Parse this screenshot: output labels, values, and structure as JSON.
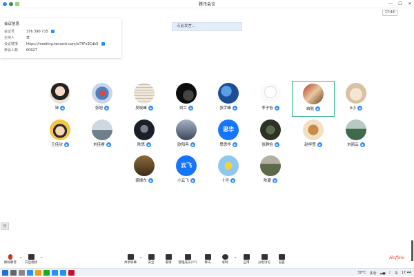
{
  "window": {
    "title": "腾讯会议",
    "time": "17:44"
  },
  "meeting_info": {
    "heading": "会议信息",
    "rows": [
      {
        "key": "会议号",
        "value": "376 390 715"
      },
      {
        "key": "主持人",
        "value": "李"
      },
      {
        "key": "会议链接",
        "value": "https://meeting.tencent.com/s/7tFx3Cdk5"
      },
      {
        "key": "参会人数",
        "value": "00027"
      }
    ]
  },
  "chat_input": {
    "placeholder": "点此发言..."
  },
  "participants": [
    {
      "name": "钟",
      "avatar": "cartoon-girl"
    },
    {
      "name": "张旭",
      "avatar": "cartoon-crew"
    },
    {
      "name": "吴晓峰",
      "avatar": "text-paper"
    },
    {
      "name": "刘兰",
      "avatar": "dark-photo"
    },
    {
      "name": "张宇峰",
      "avatar": "blue-sky"
    },
    {
      "name": "李子怡",
      "avatar": "sketch-face"
    },
    {
      "name": "启航",
      "avatar": "food-photo",
      "selected": true
    },
    {
      "name": "A小",
      "avatar": "cat-photo"
    },
    {
      "name": "王佳欣",
      "avatar": "cartoon-kid"
    },
    {
      "name": "刘佳睿",
      "avatar": "snow-scene"
    },
    {
      "name": "陈思",
      "avatar": "portrait-dark"
    },
    {
      "name": "欧阳冉",
      "avatar": "night-photo"
    },
    {
      "name": "思思华",
      "avatar": "blue-text",
      "avatar_text": "思华"
    },
    {
      "name": "张静怡",
      "avatar": "dark-green-photo"
    },
    {
      "name": "赵梓萱",
      "avatar": "heart-bread"
    },
    {
      "name": "刘丽云",
      "avatar": "mountain"
    },
    {
      "name": "梁振东",
      "avatar": "group-photo"
    },
    {
      "name": "小云飞",
      "avatar": "blue-text",
      "avatar_text": "云飞"
    },
    {
      "name": "十月",
      "avatar": "yellow-flower"
    },
    {
      "name": "陈夏",
      "avatar": "landscape"
    }
  ],
  "toolbar": {
    "left": [
      {
        "label": "解除静音",
        "icon": "mic-icon"
      },
      {
        "label": "开启视频",
        "icon": "camera-icon"
      }
    ],
    "center": [
      {
        "label": "共享屏幕",
        "icon": "screen-share-icon"
      },
      {
        "label": "安全",
        "icon": "shield-icon"
      },
      {
        "label": "邀请",
        "icon": "invite-icon"
      },
      {
        "label": "管理成员(27)",
        "icon": "members-icon"
      },
      {
        "label": "聊天",
        "icon": "chat-icon"
      },
      {
        "label": "录制",
        "icon": "record-icon"
      },
      {
        "label": "应用",
        "icon": "apps-icon"
      },
      {
        "label": "分组讨论",
        "icon": "breakout-icon"
      },
      {
        "label": "设置",
        "icon": "settings-icon"
      }
    ]
  },
  "taskbar": {
    "temperature": "30°C",
    "weather": "多云",
    "ime": "中",
    "clock": "17:44"
  },
  "watermark": "Hoffalo"
}
